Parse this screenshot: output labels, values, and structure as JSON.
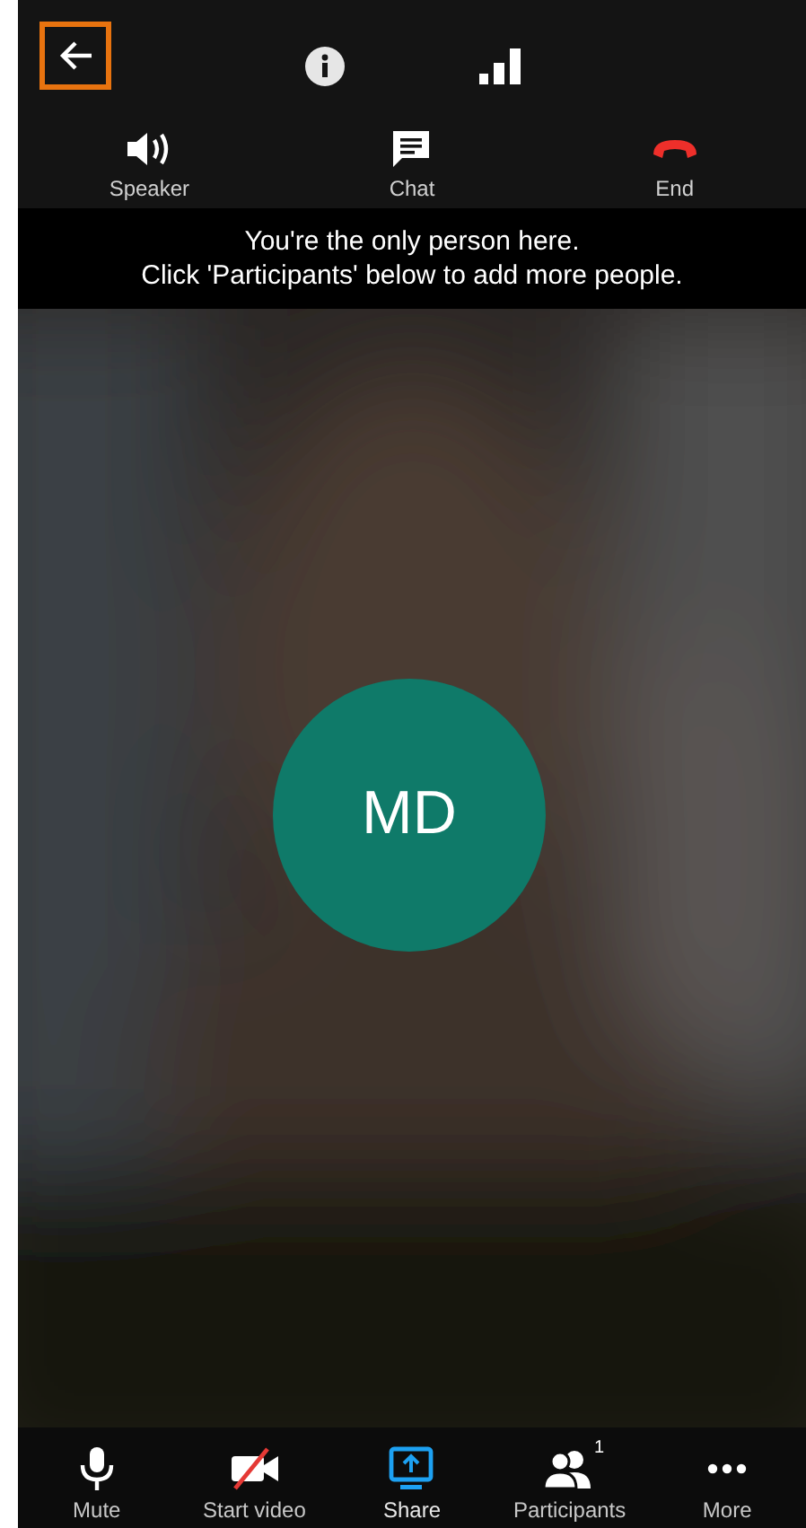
{
  "top_bar": {
    "back": {
      "highlighted": true
    },
    "icons": [
      {
        "kind": "info"
      },
      {
        "kind": "signal"
      }
    ]
  },
  "actions": [
    {
      "kind": "speaker",
      "label": "Speaker"
    },
    {
      "kind": "chat",
      "label": "Chat"
    },
    {
      "kind": "end",
      "label": "End"
    }
  ],
  "notice": [
    "You're the only person here.",
    "Click 'Participants' below to add more people."
  ],
  "avatar": {
    "initials": "MD"
  },
  "toolbar": [
    {
      "kind": "mic",
      "label": "Mute",
      "selected": false
    },
    {
      "kind": "video_off",
      "label": "Start video",
      "selected": false
    },
    {
      "kind": "share",
      "label": "Share",
      "selected": true
    },
    {
      "kind": "participants",
      "label": "Participants",
      "badge": "1",
      "selected": false
    },
    {
      "kind": "more",
      "label": "More",
      "selected": false
    }
  ]
}
